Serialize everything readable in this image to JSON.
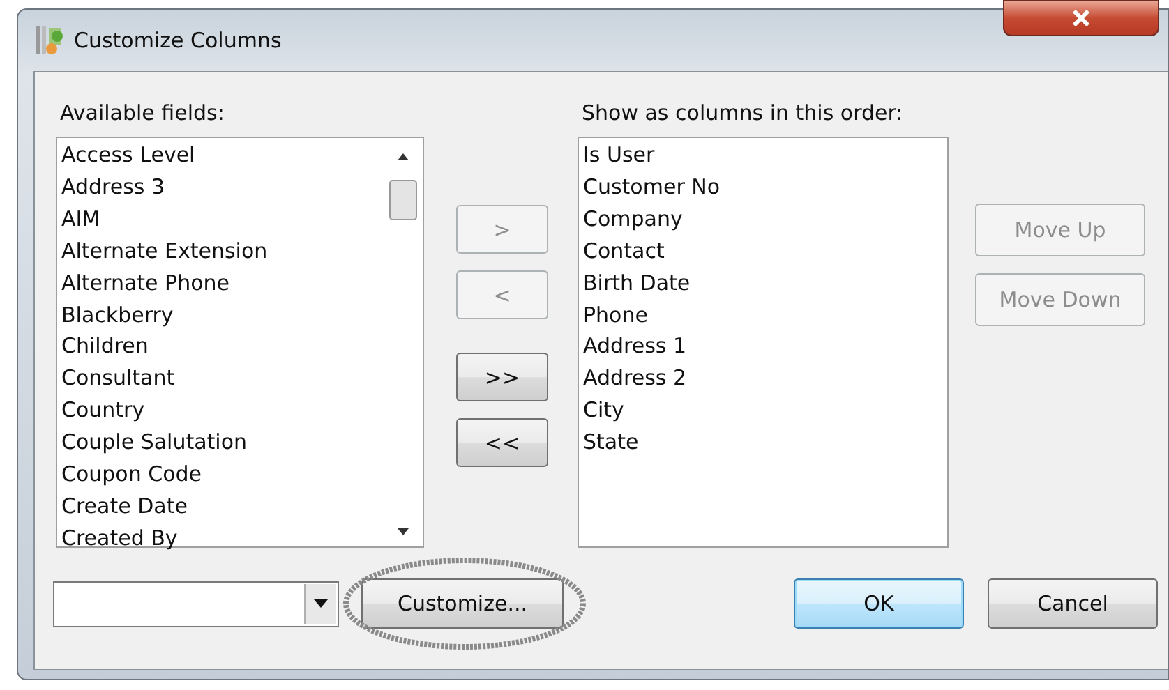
{
  "window": {
    "title": "Customize Columns"
  },
  "available": {
    "label": "Available fields:",
    "items": [
      "Access Level",
      "Address 3",
      "AIM",
      "Alternate Extension",
      "Alternate Phone",
      "Blackberry",
      "Children",
      "Consultant",
      "Country",
      "Couple Salutation",
      "Coupon Code",
      "Create Date",
      "Created By"
    ]
  },
  "shown": {
    "label": "Show as columns in this order:",
    "items": [
      "Is User",
      "Customer No",
      "Company",
      "Contact",
      "Birth Date",
      "Phone",
      "Address 1",
      "Address 2",
      "City",
      "State"
    ]
  },
  "transfer_buttons": [
    {
      "label": ">",
      "disabled": true
    },
    {
      "label": "<",
      "disabled": true
    },
    {
      "label": ">>",
      "disabled": false
    },
    {
      "label": "<<",
      "disabled": false
    }
  ],
  "order_buttons": [
    {
      "label": "Move Up",
      "disabled": true
    },
    {
      "label": "Move Down",
      "disabled": true
    }
  ],
  "bottom_buttons": [
    {
      "label": "Customize...",
      "kind": "plain",
      "circled": true
    },
    {
      "label": "OK",
      "kind": "default",
      "circled": false
    },
    {
      "label": "Cancel",
      "kind": "plain",
      "circled": false
    }
  ]
}
